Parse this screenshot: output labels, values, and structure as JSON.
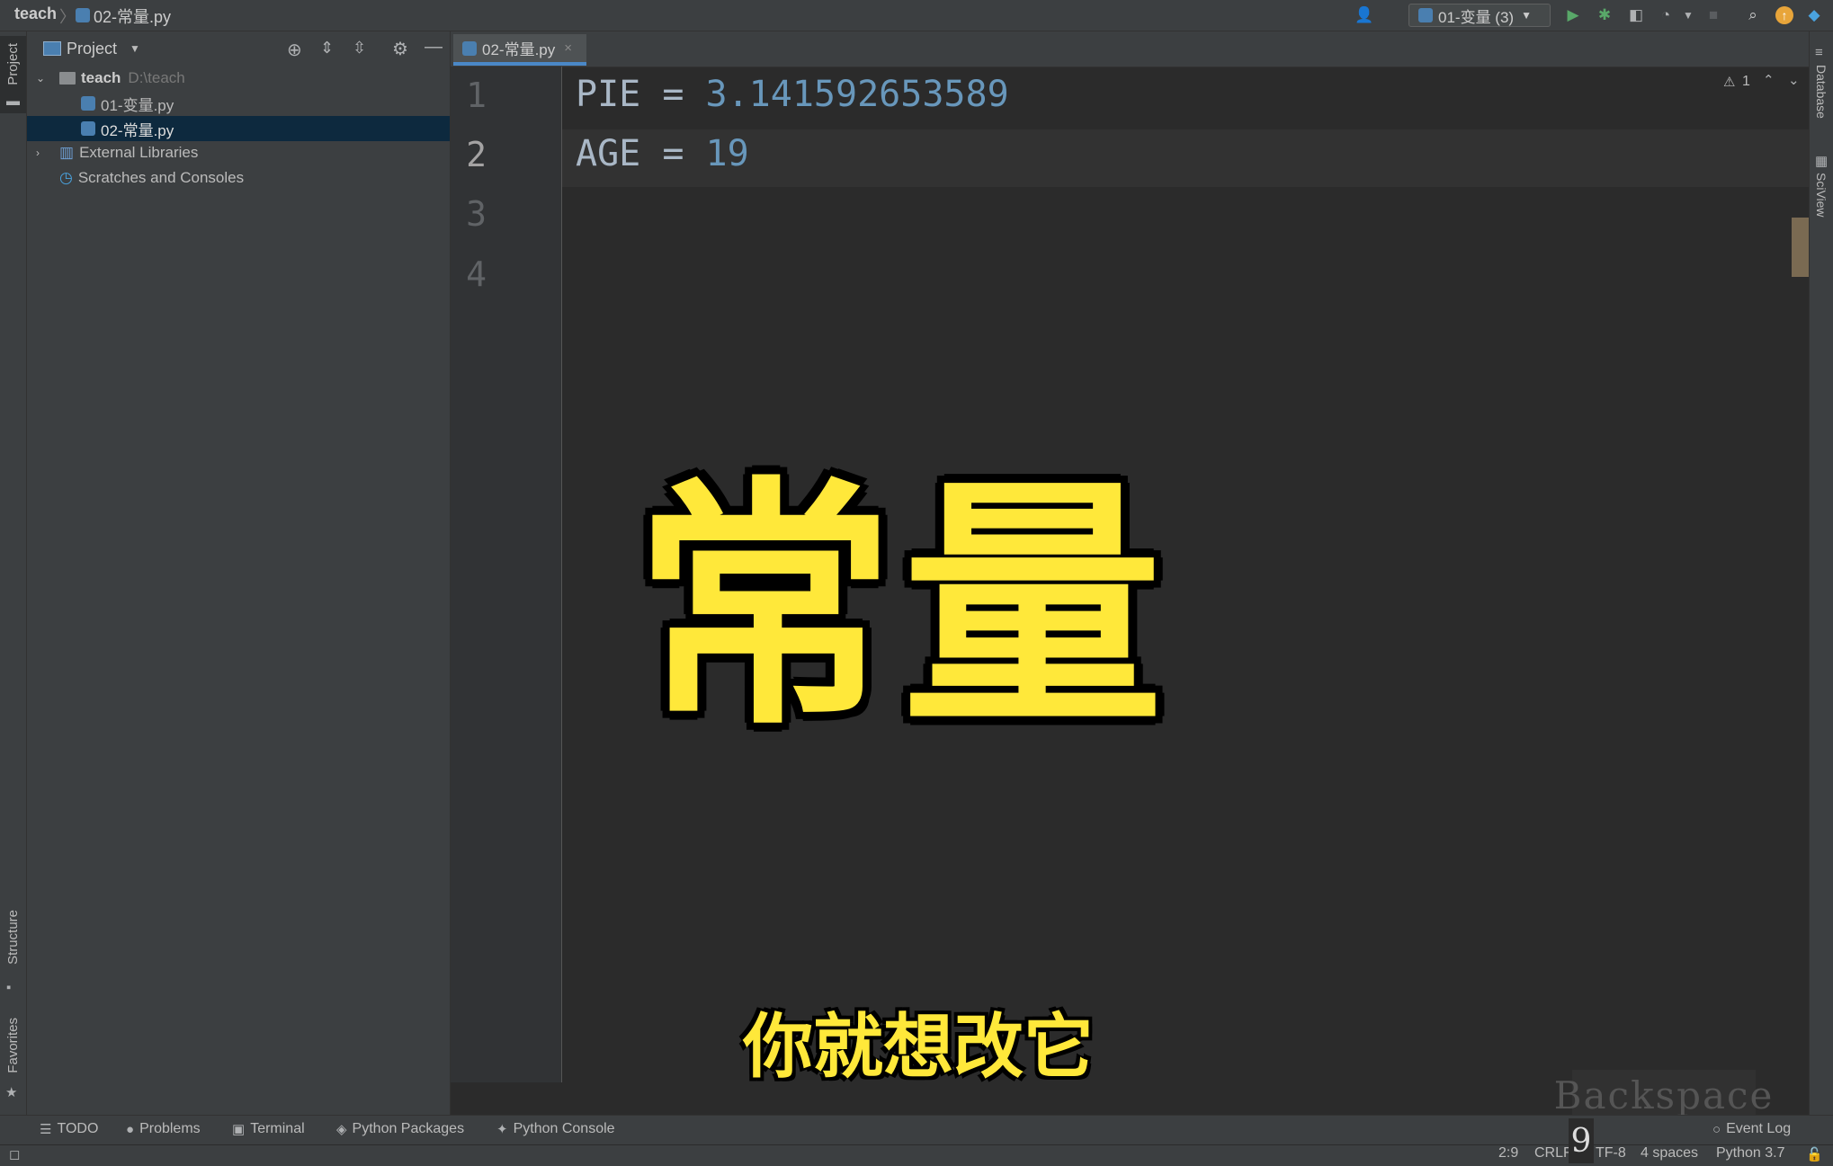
{
  "breadcrumb": {
    "project": "teach",
    "file": "02-常量.py"
  },
  "toolbar": {
    "run_config": "01-变量 (3)"
  },
  "project_panel": {
    "title": "Project",
    "tree": [
      {
        "label": "teach",
        "path": "D:\\teach"
      },
      {
        "label": "01-变量.py"
      },
      {
        "label": "02-常量.py"
      },
      {
        "label": "External Libraries"
      },
      {
        "label": "Scratches and Consoles"
      }
    ]
  },
  "left_tabs": {
    "project": "Project",
    "structure": "Structure",
    "favorites": "Favorites"
  },
  "right_tabs": {
    "database": "Database",
    "sciview": "SciView"
  },
  "editor": {
    "tab": "02-常量.py",
    "warnings": "1",
    "line_numbers": [
      "1",
      "2",
      "3",
      "4"
    ],
    "lines": [
      {
        "name": "PIE",
        "op": " = ",
        "value": "3.141592653589"
      },
      {
        "name": "AGE",
        "op": " = ",
        "value": "19"
      }
    ]
  },
  "overlay": {
    "title": "常量",
    "subtitle": "你就想改它",
    "key": "Backspace",
    "key_digit": "9"
  },
  "bottom_tools": {
    "todo": "TODO",
    "problems": "Problems",
    "terminal": "Terminal",
    "packages": "Python Packages",
    "console": "Python Console",
    "event_log": "Event Log"
  },
  "status": {
    "position": "2:9",
    "line_sep": "CRLF",
    "encoding": "TF-8",
    "indent": "4 spaces",
    "interpreter": "Python 3.7"
  },
  "colors": {
    "accent": "#4a88c7",
    "number": "#6897bb",
    "overlay_text": "#ffe83a"
  }
}
